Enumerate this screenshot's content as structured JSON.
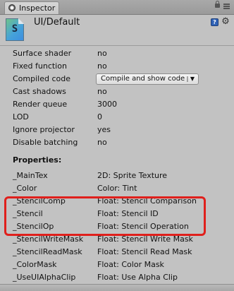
{
  "window": {
    "tab_label": "Inspector",
    "title": "UI/Default",
    "shader_icon_letter": "S"
  },
  "info": [
    {
      "label": "Surface shader",
      "value": "no"
    },
    {
      "label": "Fixed function",
      "value": "no"
    },
    {
      "label": "Compiled code",
      "value": ""
    },
    {
      "label": "Cast shadows",
      "value": "no"
    },
    {
      "label": "Render queue",
      "value": "3000"
    },
    {
      "label": "LOD",
      "value": "0"
    },
    {
      "label": "Ignore projector",
      "value": "yes"
    },
    {
      "label": "Disable batching",
      "value": "no"
    }
  ],
  "compiled_code_button": "Compile and show code",
  "properties_heading": "Properties:",
  "properties": [
    {
      "name": "_MainTex",
      "value": "2D: Sprite Texture"
    },
    {
      "name": "_Color",
      "value": "Color: Tint"
    },
    {
      "name": "_StencilComp",
      "value": "Float: Stencil Comparison"
    },
    {
      "name": "_Stencil",
      "value": "Float: Stencil ID"
    },
    {
      "name": "_StencilOp",
      "value": "Float: Stencil Operation"
    },
    {
      "name": "_StencilWriteMask",
      "value": "Float: Stencil Write Mask"
    },
    {
      "name": "_StencilReadMask",
      "value": "Float: Stencil Read Mask"
    },
    {
      "name": "_ColorMask",
      "value": "Float: Color Mask"
    },
    {
      "name": "_UseUIAlphaClip",
      "value": "Float: Use Alpha Clip"
    }
  ],
  "icons": {
    "tab": "inspector-icon",
    "lock": "lock-icon",
    "menu": "menu-icon",
    "help": "help-icon",
    "settings": "gear-icon"
  },
  "colors": {
    "panel_bg": "#c2c2c2",
    "highlight": "#e0201c"
  }
}
